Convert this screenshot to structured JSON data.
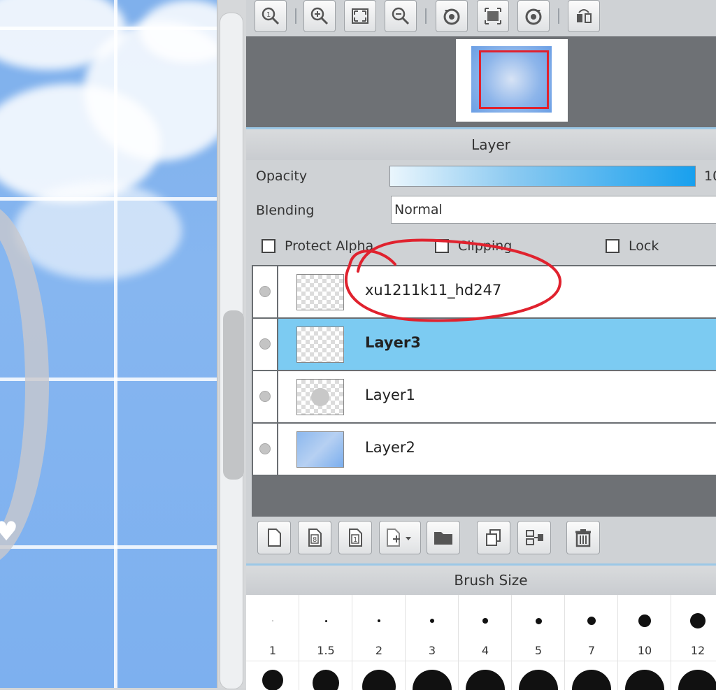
{
  "toolbar": {
    "icons": [
      "zoom-actual-icon",
      "zoom-in-icon",
      "fit-window-icon",
      "zoom-out-icon",
      "rotate-left-icon",
      "reset-view-icon",
      "rotate-right-icon",
      "flip-horizontal-icon"
    ]
  },
  "layer_panel": {
    "title": "Layer",
    "opacity_label": "Opacity",
    "opacity_value": "10",
    "opacity_level_percent": 100,
    "blending_label": "Blending",
    "blending_value": "Normal",
    "protect_alpha_label": "Protect Alpha",
    "clipping_label": "Clipping",
    "lock_label": "Lock",
    "layers": [
      {
        "name": "xu1211k11_hd247",
        "selected": false
      },
      {
        "name": "Layer3",
        "selected": true
      },
      {
        "name": "Layer1",
        "selected": false
      },
      {
        "name": "Layer2",
        "selected": false
      }
    ],
    "buttons": [
      "new-layer-icon",
      "new-8bit-layer-icon",
      "new-1bit-layer-icon",
      "add-layer-menu-icon",
      "new-folder-icon",
      "duplicate-layer-icon",
      "merge-down-icon",
      "delete-layer-icon"
    ]
  },
  "brush_panel": {
    "title": "Brush Size",
    "sizes": [
      "1",
      "1.5",
      "2",
      "3",
      "4",
      "5",
      "7",
      "10",
      "12"
    ]
  },
  "colors": {
    "selection": "#7ccbf2",
    "annotation": "#e0222e",
    "accent": "#18a0ee"
  }
}
